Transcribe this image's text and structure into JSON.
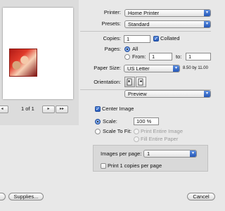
{
  "preview": {
    "page_indicator": "1 of 1"
  },
  "printer": {
    "label": "Printer:",
    "value": "Home Printer"
  },
  "presets": {
    "label": "Presets:",
    "value": "Standard"
  },
  "copies": {
    "label": "Copies:",
    "value": "1",
    "collated_label": "Collated"
  },
  "pages": {
    "label": "Pages:",
    "all_label": "All",
    "from_label": "From:",
    "from_value": "1",
    "to_label": "to:",
    "to_value": "1"
  },
  "paper_size": {
    "label": "Paper Size:",
    "value": "US Letter",
    "dims": "8.50 by 11.00"
  },
  "orientation": {
    "label": "Orientation:"
  },
  "section": {
    "value": "Preview"
  },
  "center_image": {
    "label": "Center Image"
  },
  "scale": {
    "label": "Scale:",
    "value": "100 %"
  },
  "scale_to_fit": {
    "label": "Scale To Fit:",
    "option1": "Print Entire Image",
    "option2": "Fill Entire Paper"
  },
  "images_per_page": {
    "label": "Images per page:",
    "value": "1"
  },
  "print_copies": {
    "label": "Print 1 copies per page"
  },
  "buttons": {
    "supplies": "Supplies...",
    "cancel": "Cancel"
  },
  "icons": {
    "arrow": "▾",
    "first": "|◂",
    "prev": "◂",
    "next": "▸",
    "last": "▸▸",
    "check": "✓"
  }
}
